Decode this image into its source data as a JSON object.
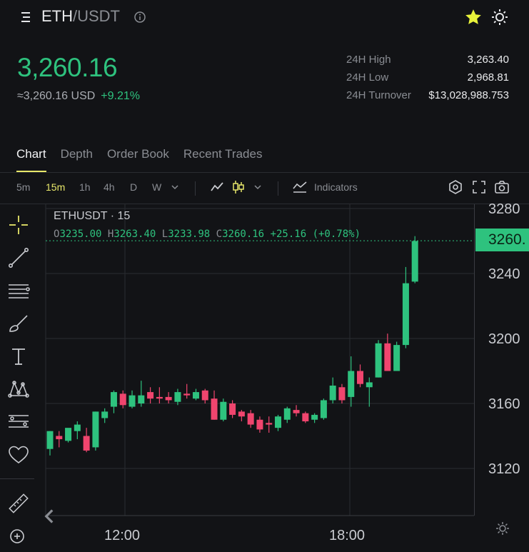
{
  "header": {
    "base": "ETH",
    "quote": "/USDT",
    "menu_icon": "menu-icon",
    "info_icon": "info-icon",
    "favorite_icon": "star-icon",
    "theme_icon": "sun-icon",
    "accent_color": "#e8e86a"
  },
  "price": {
    "last": "3,260.16",
    "usd": "≈3,260.16 USD",
    "change": "+9.21%",
    "up_color": "#2ec27e",
    "down_color": "#f0456e"
  },
  "stats": [
    {
      "label": "24H High",
      "value": "3,263.40"
    },
    {
      "label": "24H Low",
      "value": "2,968.81"
    },
    {
      "label": "24H Turnover",
      "value": "$13,028,988.753"
    }
  ],
  "tabs": [
    {
      "label": "Chart",
      "active": true
    },
    {
      "label": "Depth",
      "active": false
    },
    {
      "label": "Order Book",
      "active": false
    },
    {
      "label": "Recent Trades",
      "active": false
    }
  ],
  "toolbar": {
    "intervals": [
      "5m",
      "15m",
      "1h",
      "4h",
      "D",
      "W"
    ],
    "active_interval": "15m",
    "indicators_label": "Indicators"
  },
  "legend": {
    "title": "ETHUSDT · 15",
    "o_key": "O",
    "o": "3235.00",
    "h_key": "H",
    "h": "3263.40",
    "l_key": "L",
    "l": "3233.98",
    "c_key": "C",
    "c": "3260.16",
    "change": "+25.16 (+0.78%)"
  },
  "chart_data": {
    "type": "candlestick",
    "title": "ETHUSDT · 15",
    "x_ticks": [
      "12:00",
      "18:00"
    ],
    "y_ticks": [
      3280,
      3240,
      3200,
      3160,
      3120
    ],
    "ylim": [
      3110,
      3285
    ],
    "last_price_label": "3260.",
    "last_price": 3260.16,
    "candles": [
      [
        3132,
        3143,
        3128,
        3143
      ],
      [
        3140,
        3138,
        3133,
        3143
      ],
      [
        3137,
        3145,
        3136,
        3141
      ],
      [
        3143,
        3147,
        3138,
        3149
      ],
      [
        3140,
        3131,
        3130,
        3145
      ],
      [
        3133,
        3155,
        3131,
        3155
      ],
      [
        3151,
        3155,
        3148,
        3157
      ],
      [
        3158,
        3167,
        3154,
        3168
      ],
      [
        3166,
        3159,
        3157,
        3168
      ],
      [
        3158,
        3165,
        3157,
        3168
      ],
      [
        3160,
        3165,
        3158,
        3174
      ],
      [
        3167,
        3163,
        3160,
        3170
      ],
      [
        3164,
        3163,
        3160,
        3170
      ],
      [
        3164,
        3162,
        3160,
        3167
      ],
      [
        3161,
        3167,
        3159,
        3169
      ],
      [
        3166,
        3165,
        3163,
        3172
      ],
      [
        3163,
        3167,
        3162,
        3169
      ],
      [
        3168,
        3162,
        3160,
        3169
      ],
      [
        3163,
        3150,
        3150,
        3168
      ],
      [
        3150,
        3161,
        3149,
        3163
      ],
      [
        3160,
        3153,
        3151,
        3162
      ],
      [
        3155,
        3152,
        3149,
        3156
      ],
      [
        3154,
        3147,
        3145,
        3156
      ],
      [
        3150,
        3144,
        3142,
        3152
      ],
      [
        3148,
        3147,
        3142,
        3152
      ],
      [
        3145,
        3152,
        3143,
        3153
      ],
      [
        3150,
        3157,
        3148,
        3158
      ],
      [
        3156,
        3154,
        3152,
        3159
      ],
      [
        3154,
        3149,
        3148,
        3155
      ],
      [
        3150,
        3153,
        3148,
        3154
      ],
      [
        3151,
        3162,
        3150,
        3163
      ],
      [
        3162,
        3171,
        3160,
        3176
      ],
      [
        3170,
        3162,
        3160,
        3172
      ],
      [
        3164,
        3180,
        3158,
        3189
      ],
      [
        3180,
        3172,
        3170,
        3184
      ],
      [
        3170,
        3173,
        3158,
        3176
      ],
      [
        3176,
        3197,
        3176,
        3199
      ],
      [
        3197,
        3180,
        3180,
        3203
      ],
      [
        3180,
        3196,
        3180,
        3198
      ],
      [
        3196,
        3234,
        3194,
        3244
      ],
      [
        3235,
        3260,
        3234,
        3263
      ]
    ]
  }
}
